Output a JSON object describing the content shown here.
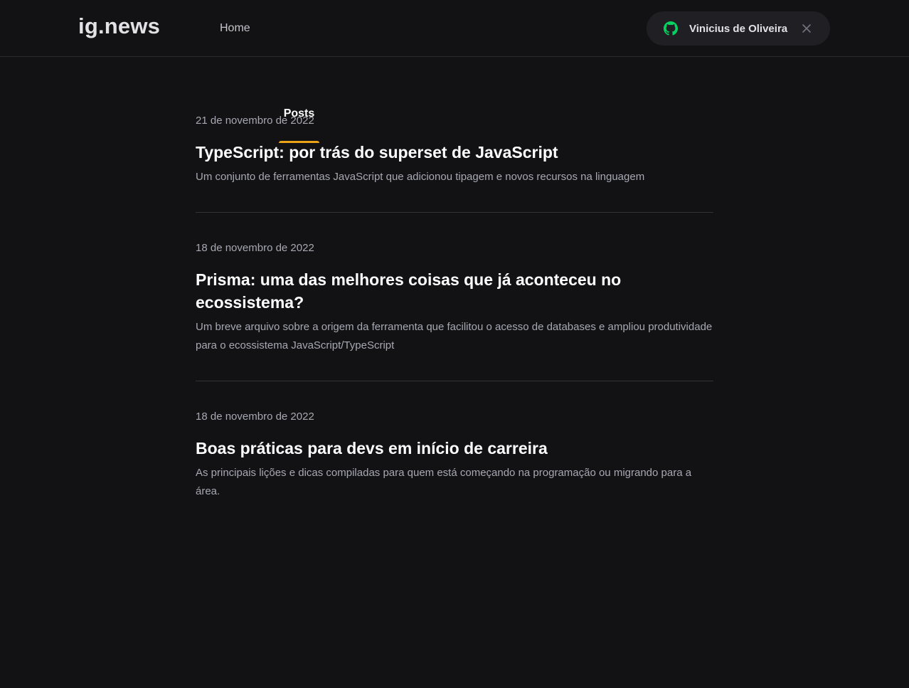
{
  "header": {
    "logo": "ig.news",
    "nav": [
      {
        "label": "Home"
      },
      {
        "label": "Posts",
        "active": true
      }
    ],
    "user": {
      "name": "Vinicius de Oliveira",
      "icon": "github-icon",
      "close_icon": "close-icon"
    }
  },
  "posts": [
    {
      "date": "21 de novembro de 2022",
      "title": "TypeScript: por trás do superset de JavaScript",
      "excerpt": "Um conjunto de ferramentas JavaScript que adicionou tipagem e novos recursos na linguagem"
    },
    {
      "date": "18 de novembro de 2022",
      "title": "Prisma: uma das melhores coisas que já aconteceu no ecossistema?",
      "excerpt": "Um breve arquivo sobre a origem da ferramenta que facilitou o acesso de databases e ampliou produtividade para o ecossistema JavaScript/TypeScript"
    },
    {
      "date": "18 de novembro de 2022",
      "title": "Boas práticas para devs em início de carreira",
      "excerpt": "As principais lições e dicas compiladas para quem está começando na programação ou migrando para a área."
    }
  ],
  "colors": {
    "background": "#121214",
    "accent": "#eba417",
    "github_green": "#04d361"
  }
}
